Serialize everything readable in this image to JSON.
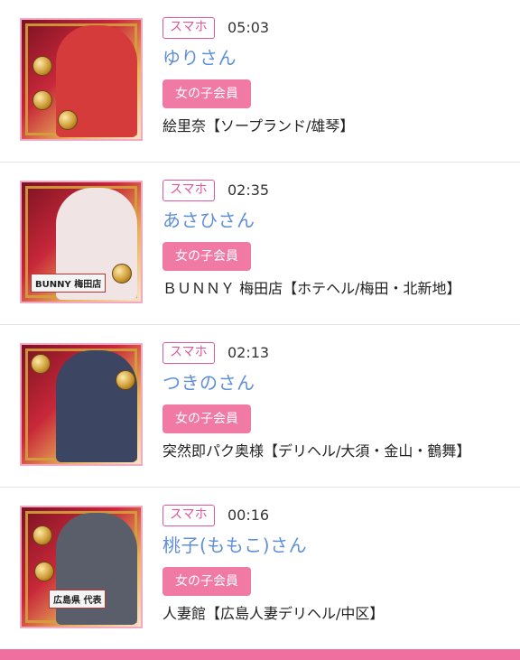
{
  "items": [
    {
      "tag": "スマホ",
      "time": "05:03",
      "name": "ゆりさん",
      "member": "女の子会員",
      "shop": "絵里奈【ソープランド/雄琴】",
      "photo_color": "#d63b3b",
      "stamp": ""
    },
    {
      "tag": "スマホ",
      "time": "02:35",
      "name": "あさひさん",
      "member": "女の子会員",
      "shop": "ＢＵＮＮＹ 梅田店【ホテヘル/梅田・北新地】",
      "photo_color": "#f1e4e4",
      "stamp": "BUNNY 梅田店"
    },
    {
      "tag": "スマホ",
      "time": "02:13",
      "name": "つきのさん",
      "member": "女の子会員",
      "shop": "突然即パク奥様【デリヘル/大須・金山・鶴舞】",
      "photo_color": "#3c4561",
      "stamp": ""
    },
    {
      "tag": "スマホ",
      "time": "00:16",
      "name": "桃子(ももこ)さん",
      "member": "女の子会員",
      "shop": "人妻館【広島人妻デリヘル/中区】",
      "photo_color": "#5a5e6a",
      "stamp": "広島県 代表"
    }
  ],
  "colors": {
    "accent": "#e0569a",
    "name": "#5f8fd8",
    "member_bg": "#f07aa4",
    "bar": "#ef6f9e"
  }
}
